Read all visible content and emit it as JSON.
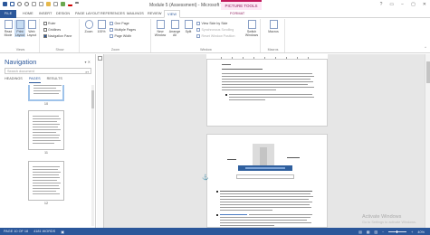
{
  "window": {
    "title": "Module 5 (Assessment) - Microsoft Word",
    "contextual_tab_group": "PICTURE TOOLS",
    "controls": [
      "?",
      "▭",
      "−",
      "▢",
      "✕"
    ]
  },
  "tabs": [
    "FILE",
    "HOME",
    "INSERT",
    "DESIGN",
    "PAGE LAYOUT",
    "REFERENCES",
    "MAILINGS",
    "REVIEW",
    "VIEW",
    "FORMAT"
  ],
  "active_tab": "VIEW",
  "ribbon": {
    "views": {
      "label": "Views",
      "read_mode": "Read Mode",
      "print_layout": "Print Layout",
      "web_layout": "Web Layout"
    },
    "show": {
      "label": "Show",
      "ruler": "Ruler",
      "gridlines": "Gridlines",
      "navigation_pane": "Navigation Pane"
    },
    "zoom": {
      "label": "Zoom",
      "zoom": "Zoom",
      "hundred": "100%",
      "one_page": "One Page",
      "multiple_pages": "Multiple Pages",
      "page_width": "Page Width"
    },
    "window": {
      "label": "Window",
      "new_window": "New Window",
      "arrange_all": "Arrange All",
      "split": "Split",
      "side_by_side": "View Side by Side",
      "sync_scroll": "Synchronous Scrolling",
      "reset_position": "Reset Window Position",
      "switch_windows": "Switch Windows"
    },
    "macros": {
      "label": "Macros",
      "macros": "Macros"
    }
  },
  "navigation": {
    "title": "Navigation",
    "controls": "▾ ✕",
    "search_placeholder": "Search document",
    "tabs": [
      "HEADINGS",
      "PAGES",
      "RESULTS"
    ],
    "active_tab": "PAGES",
    "page_numbers": [
      "10",
      "11",
      "12"
    ]
  },
  "document": {
    "watermark_line1": "Activate Windows",
    "watermark_line2": "Go to Settings to activate Windows."
  },
  "status": {
    "page": "PAGE 10 OF 18",
    "words": "4181 WORDS",
    "zoom": "40%"
  }
}
